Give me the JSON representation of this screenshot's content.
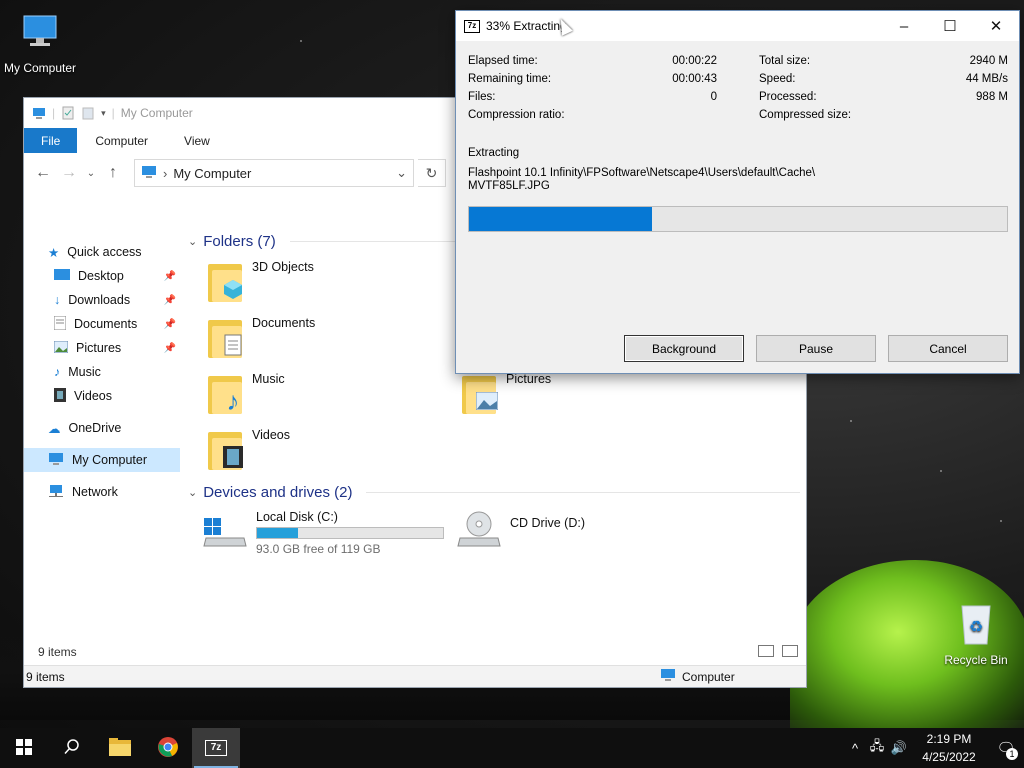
{
  "desktop": {
    "icons": [
      {
        "label": "My Computer",
        "icon": "computer-icon"
      },
      {
        "label": "Recycle Bin",
        "icon": "recycle-bin-icon"
      }
    ]
  },
  "explorer": {
    "title": "My Computer",
    "ribbon_tabs": [
      "File",
      "Computer",
      "View"
    ],
    "address": "My Computer",
    "nav_pane": [
      {
        "label": "Quick access",
        "icon": "star-icon"
      },
      {
        "label": "Desktop",
        "icon": "desktop-icon",
        "pinned": true
      },
      {
        "label": "Downloads",
        "icon": "download-icon",
        "pinned": true
      },
      {
        "label": "Documents",
        "icon": "documents-icon",
        "pinned": true
      },
      {
        "label": "Pictures",
        "icon": "pictures-icon",
        "pinned": true
      },
      {
        "label": "Music",
        "icon": "music-icon"
      },
      {
        "label": "Videos",
        "icon": "videos-icon"
      },
      {
        "label": "OneDrive",
        "icon": "cloud-icon"
      },
      {
        "label": "My Computer",
        "icon": "computer-icon",
        "selected": true
      },
      {
        "label": "Network",
        "icon": "network-icon"
      }
    ],
    "folders_header": "Folders (7)",
    "folders": [
      {
        "label": "3D Objects",
        "icon": "3d-objects-icon"
      },
      {
        "label": "Documents",
        "icon": "document-icon"
      },
      {
        "label": "Music",
        "icon": "music-note-icon"
      },
      {
        "label": "Videos",
        "icon": "film-icon"
      },
      {
        "label": "Pictures",
        "icon": "picture-icon"
      }
    ],
    "devices_header": "Devices and drives (2)",
    "drives": [
      {
        "label": "Local Disk (C:)",
        "free_text": "93.0 GB free of 119 GB",
        "used_fraction": 0.22
      },
      {
        "label": "CD Drive (D:)"
      }
    ],
    "status_items": "9 items",
    "status_items_bottom": "9 items",
    "status_computer": "Computer"
  },
  "zip": {
    "title": "33% Extracting",
    "logo": "7z",
    "left_stats": [
      {
        "label": "Elapsed time:",
        "value": "00:00:22"
      },
      {
        "label": "Remaining time:",
        "value": "00:00:43"
      },
      {
        "label": "Files:",
        "value": "0"
      },
      {
        "label": "Compression ratio:",
        "value": ""
      }
    ],
    "right_stats": [
      {
        "label": "Total size:",
        "value": "2940 M"
      },
      {
        "label": "Speed:",
        "value": "44 MB/s"
      },
      {
        "label": "Processed:",
        "value": "988 M"
      },
      {
        "label": "Compressed size:",
        "value": ""
      }
    ],
    "operation": "Extracting",
    "path_line1": "Flashpoint 10.1 Infinity\\FPSoftware\\Netscape4\\Users\\default\\Cache\\",
    "path_line2": "MVTF85LF.JPG",
    "progress_percent": 34,
    "buttons": {
      "background": "Background",
      "pause": "Pause",
      "cancel": "Cancel"
    }
  },
  "taskbar": {
    "apps": [
      {
        "name": "start-button",
        "icon": "windows-logo-icon"
      },
      {
        "name": "search-button",
        "icon": "search-icon"
      },
      {
        "name": "file-explorer-button",
        "icon": "folder-icon"
      },
      {
        "name": "chrome-button",
        "icon": "chrome-icon"
      },
      {
        "name": "7zip-button",
        "icon": "7zip-icon",
        "label": "7z",
        "active": true
      }
    ],
    "time": "2:19 PM",
    "date": "4/25/2022",
    "notifications": "1"
  },
  "colors": {
    "accent": "#0078d7",
    "progress": "#0678d4",
    "drive_bar": "#26a0da",
    "selected": "#cce8ff"
  }
}
